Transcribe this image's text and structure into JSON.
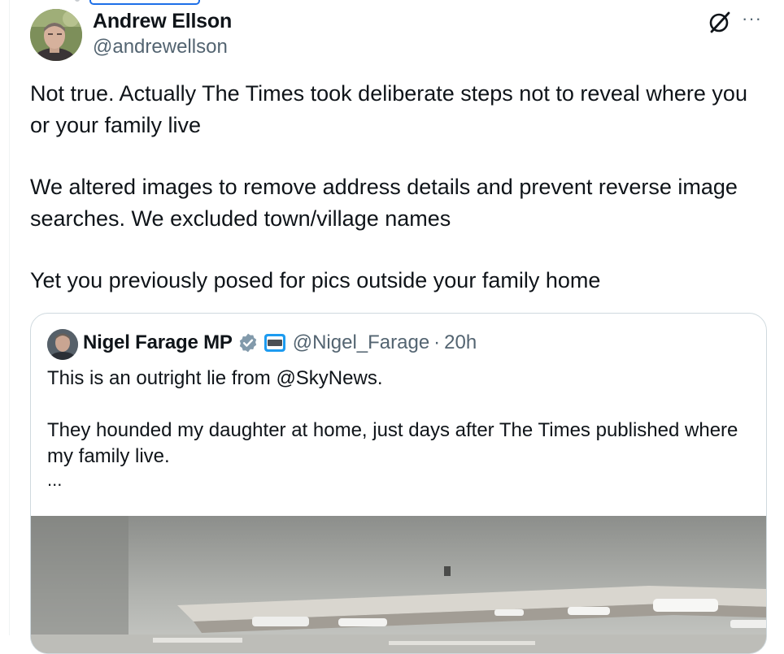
{
  "tweet": {
    "author_name": "Andrew Ellson",
    "author_handle": "@andrewellson",
    "more_label": "···",
    "paragraphs": [
      "Not true. Actually The Times took deliberate steps not to reveal where you or your family live",
      "We altered images to remove address details and prevent reverse image searches. We excluded town/village names",
      "Yet you previously posed for pics outside your family home"
    ]
  },
  "quote": {
    "author_name": "Nigel Farage MP",
    "author_handle": "@Nigel_Farage",
    "separator": "·",
    "time": "20h",
    "paragraphs": [
      "This is an outright lie from @SkyNews.",
      "They hounded my daughter at home, just days after The Times published where my family live."
    ],
    "truncation": "..."
  },
  "icons": {
    "grok": "grok-icon",
    "more": "more-icon",
    "verified": "verified-badge-icon",
    "affiliation": "affiliation-badge-icon"
  },
  "colors": {
    "text": "#0f1419",
    "secondary": "#536471",
    "border": "#cfd9de",
    "verified": "#829aab",
    "accent": "#1d9bf0"
  }
}
